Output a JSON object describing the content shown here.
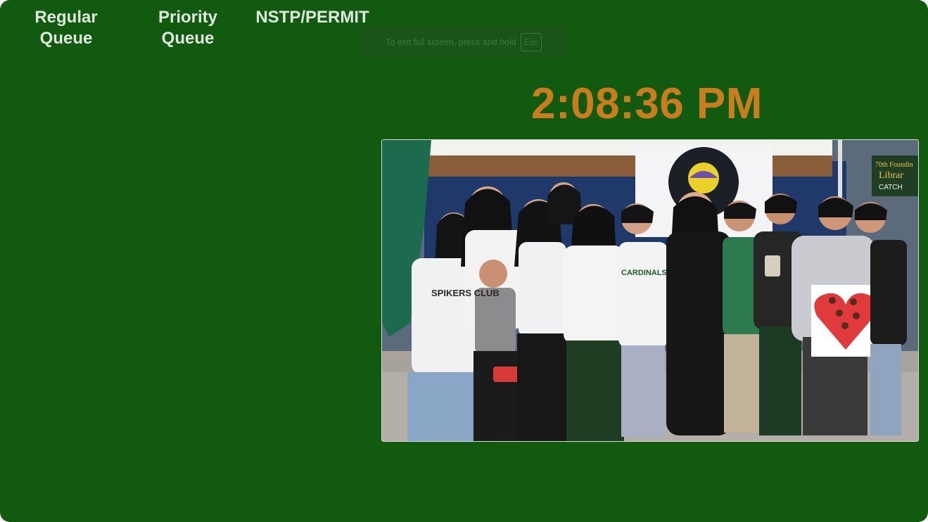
{
  "queues": {
    "regular": "Regular\nQueue",
    "priority": "Priority\nQueue",
    "nstp": "NSTP/PERMIT"
  },
  "fullscreen_notice": {
    "text": "To exit full screen, press and hold",
    "key": "Esc"
  },
  "clock": {
    "time": "2:08:36 PM"
  },
  "photo": {
    "banner_text": "70th Foundin",
    "banner_subtext": "Librar",
    "banner_subtext2": "CATCH",
    "shirt_text": "SPIKERS CLUB",
    "shirt_text2": "CARDINALS"
  },
  "colors": {
    "background": "#135a11",
    "label": "#dfe8dd",
    "clock": "#c97d1c"
  }
}
